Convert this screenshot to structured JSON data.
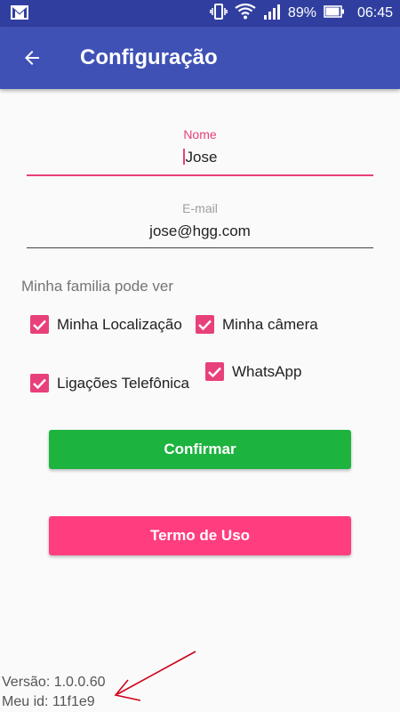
{
  "status_bar": {
    "battery": "89%",
    "time": "06:45",
    "icons": [
      "gmail-icon",
      "vibrate-icon",
      "wifi-icon",
      "signal-icon",
      "battery-icon"
    ]
  },
  "app_bar": {
    "title": "Configuração",
    "back_icon": "arrow-back-icon"
  },
  "form": {
    "name": {
      "label": "Nome",
      "value": "Jose"
    },
    "email": {
      "label": "E-mail",
      "value": "jose@hgg.com"
    }
  },
  "permissions": {
    "title": "Minha familia pode ver",
    "options": [
      {
        "label": "Minha Localização",
        "checked": true
      },
      {
        "label": "Minha câmera",
        "checked": true
      },
      {
        "label": "Ligações Telefônica",
        "checked": true
      },
      {
        "label": "WhatsApp",
        "checked": true
      }
    ]
  },
  "buttons": {
    "confirm": "Confirmar",
    "terms": "Termo de Uso"
  },
  "footer": {
    "version": "Versão: 1.0.0.60",
    "my_id": "Meu id: 11f1e9"
  },
  "colors": {
    "status_bar": "#303f9f",
    "app_bar": "#3f51b5",
    "accent": "#e8407a",
    "confirm_button": "#1db33f",
    "terms_button": "#ff3d7f",
    "annotation_arrow": "#d0021b"
  }
}
